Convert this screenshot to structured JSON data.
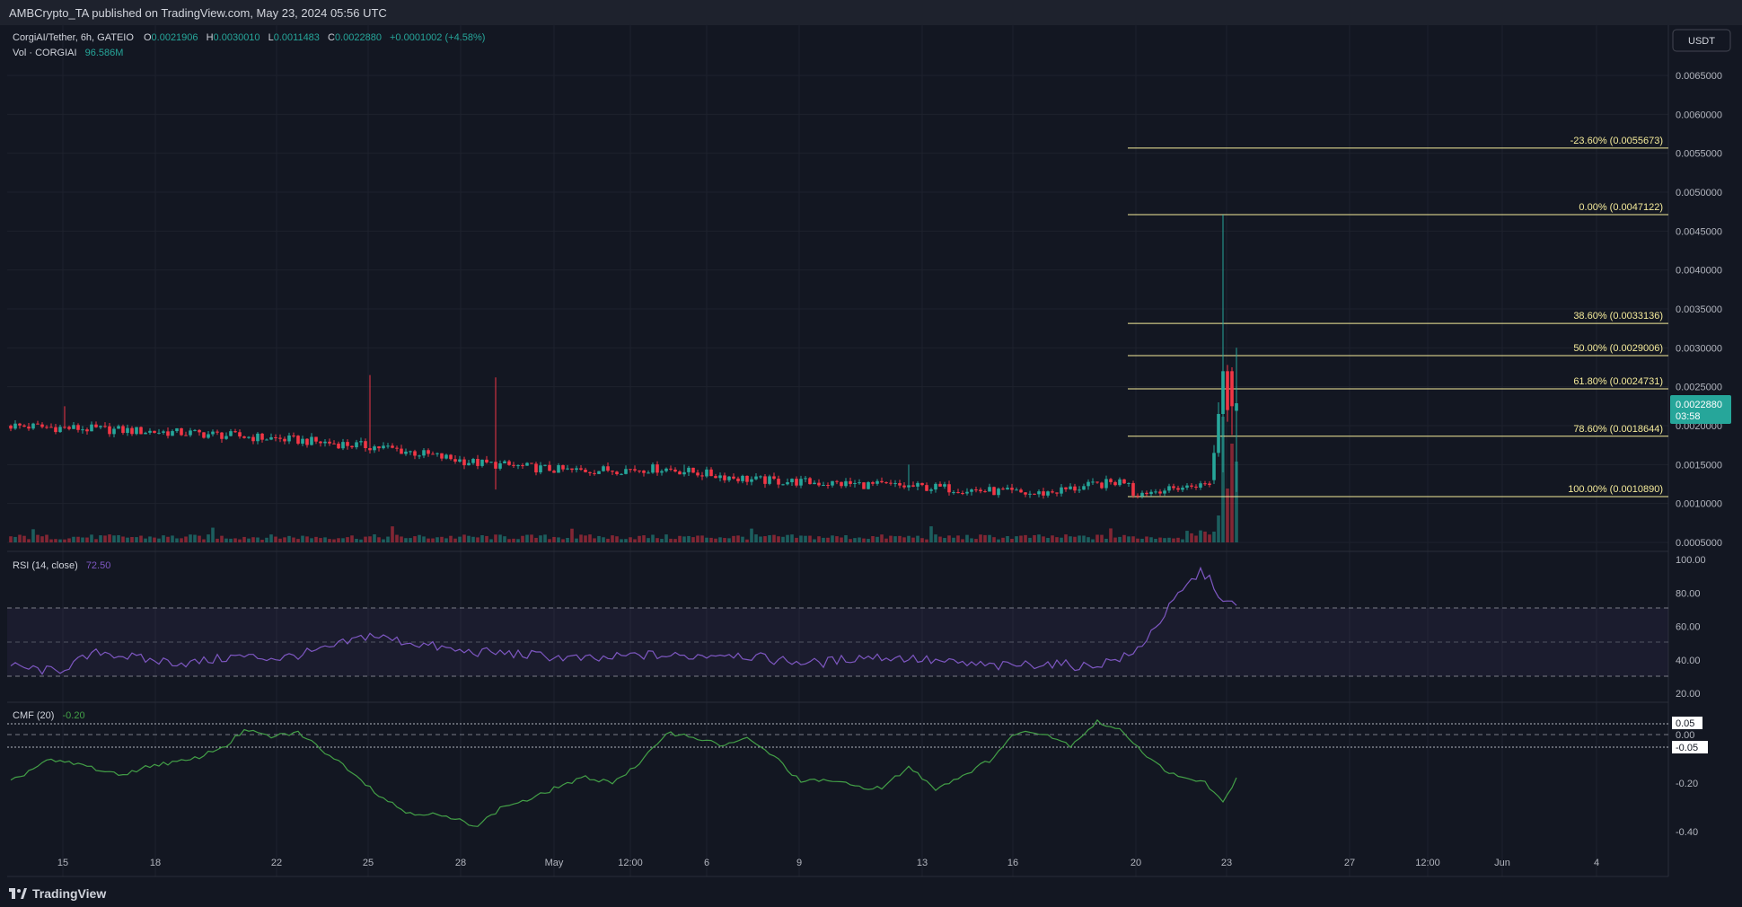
{
  "header": {
    "published": "AMBCrypto_TA published on TradingView.com, May 23, 2024 05:56 UTC"
  },
  "legend": {
    "symbol": "CorgiAI/Tether, 6h, GATEIO",
    "O_label": "O",
    "O": "0.0021906",
    "H_label": "H",
    "H": "0.0030010",
    "L_label": "L",
    "L": "0.0011483",
    "C_label": "C",
    "C": "0.0022880",
    "change": "+0.0001002 (+4.58%)",
    "vol_label": "Vol · CORGIAI",
    "vol_value": "96.586M"
  },
  "currency_button": "USDT",
  "last_price": {
    "price": "0.0022880",
    "countdown": "03:58"
  },
  "footer": {
    "brand": "TradingView"
  },
  "colors": {
    "background": "#131722",
    "up": "#26a69a",
    "down": "#f23645",
    "fib": "#f5eb9a",
    "rsi": "#7e57c2",
    "cmf": "#43a047"
  },
  "chart_data": [
    {
      "type": "candlestick",
      "title": "CorgiAI/Tether, 6h, GATEIO",
      "ylabel": "USDT",
      "ylim": [
        0.0003,
        0.0069
      ],
      "y_ticks": [
        "0.0065000",
        "0.0060000",
        "0.0055000",
        "0.0050000",
        "0.0045000",
        "0.0040000",
        "0.0035000",
        "0.0030000",
        "0.0025000",
        "0.0020000",
        "0.0015000",
        "0.0010000",
        "0.0005000"
      ],
      "x_tick_labels": [
        "15",
        "18",
        "22",
        "25",
        "28",
        "May",
        "12:00",
        "6",
        "9",
        "13",
        "16",
        "20",
        "23",
        "27",
        "12:00",
        "Jun",
        "4"
      ],
      "fib_levels": [
        {
          "label": "-23.60% (0.0055673)",
          "value": 0.0055673
        },
        {
          "label": "0.00% (0.0047122)",
          "value": 0.0047122
        },
        {
          "label": "38.60% (0.0033136)",
          "value": 0.0033136
        },
        {
          "label": "50.00% (0.0029006)",
          "value": 0.0029006
        },
        {
          "label": "61.80% (0.0024731)",
          "value": 0.0024731
        },
        {
          "label": "78.60% (0.0018644)",
          "value": 0.0018644
        },
        {
          "label": "100.00% (0.0010890)",
          "value": 0.001089
        }
      ],
      "price_anchors": [
        {
          "date": "Apr 13",
          "close": 0.002
        },
        {
          "date": "Apr 16",
          "close": 0.00195
        },
        {
          "date": "Apr 20",
          "close": 0.0019
        },
        {
          "date": "Apr 24",
          "close": 0.00182
        },
        {
          "date": "Apr 27",
          "close": 0.00172
        },
        {
          "date": "Apr 30",
          "close": 0.00152
        },
        {
          "date": "May 3",
          "close": 0.00142
        },
        {
          "date": "May 6",
          "close": 0.00145
        },
        {
          "date": "May 9",
          "close": 0.0013
        },
        {
          "date": "May 13",
          "close": 0.00125
        },
        {
          "date": "May 16",
          "close": 0.0012
        },
        {
          "date": "May 20",
          "close": 0.00112
        },
        {
          "date": "May 21",
          "close": 0.0013
        }
      ],
      "spike_candles": [
        {
          "label": "May 21 18:00",
          "o": 0.0013,
          "h": 0.00175,
          "l": 0.00125,
          "c": 0.00165
        },
        {
          "label": "May 22 00:00",
          "o": 0.00165,
          "h": 0.0023,
          "l": 0.0016,
          "c": 0.00215
        },
        {
          "label": "May 22 06:00",
          "o": 0.00215,
          "h": 0.00471,
          "l": 0.0014,
          "c": 0.0027
        },
        {
          "label": "May 22 12:00",
          "o": 0.0027,
          "h": 0.00278,
          "l": 0.00205,
          "c": 0.0022
        },
        {
          "label": "May 22 18:00",
          "o": 0.0027,
          "h": 0.00275,
          "l": 0.00188,
          "c": 0.00225
        },
        {
          "label": "May 23 00:00",
          "o": 0.0021906,
          "h": 0.003001,
          "l": 0.0011483,
          "c": 0.002288
        }
      ]
    },
    {
      "type": "line",
      "title": "RSI (14, close)",
      "current": "72.50",
      "ylim": [
        20,
        100
      ],
      "y_ticks": [
        "100.00",
        "80.00",
        "60.00",
        "40.00",
        "20.00"
      ],
      "bands": [
        70,
        50,
        30
      ],
      "points": [
        [
          0,
          36
        ],
        [
          10,
          33
        ],
        [
          20,
          45
        ],
        [
          30,
          40
        ],
        [
          40,
          38
        ],
        [
          50,
          42
        ],
        [
          60,
          41
        ],
        [
          70,
          46
        ],
        [
          80,
          55
        ],
        [
          85,
          52
        ],
        [
          90,
          50
        ],
        [
          100,
          45
        ],
        [
          110,
          44
        ],
        [
          120,
          42
        ],
        [
          130,
          40
        ],
        [
          140,
          43
        ],
        [
          150,
          42
        ],
        [
          160,
          44
        ],
        [
          170,
          40
        ],
        [
          180,
          38
        ],
        [
          190,
          42
        ],
        [
          200,
          41
        ],
        [
          210,
          38
        ],
        [
          220,
          36
        ],
        [
          230,
          38
        ],
        [
          240,
          36
        ],
        [
          250,
          43
        ],
        [
          255,
          60
        ],
        [
          260,
          78
        ],
        [
          265,
          93
        ],
        [
          268,
          85
        ],
        [
          270,
          74
        ],
        [
          273,
          72.5
        ]
      ]
    },
    {
      "type": "line",
      "title": "CMF (20)",
      "current": "-0.20",
      "ylim": [
        -0.45,
        0.12
      ],
      "y_ticks": [
        "0.05",
        "0.00",
        "-0.05",
        "-0.20",
        "-0.40"
      ],
      "bands": [
        0.05,
        0.0,
        -0.05
      ],
      "points": [
        [
          0,
          -0.22
        ],
        [
          8,
          -0.12
        ],
        [
          16,
          -0.14
        ],
        [
          24,
          -0.19
        ],
        [
          32,
          -0.14
        ],
        [
          40,
          -0.12
        ],
        [
          48,
          -0.05
        ],
        [
          52,
          0.02
        ],
        [
          58,
          -0.01
        ],
        [
          64,
          0.01
        ],
        [
          70,
          -0.08
        ],
        [
          76,
          -0.17
        ],
        [
          82,
          -0.28
        ],
        [
          88,
          -0.36
        ],
        [
          94,
          -0.37
        ],
        [
          100,
          -0.4
        ],
        [
          104,
          -0.42
        ],
        [
          110,
          -0.33
        ],
        [
          116,
          -0.3
        ],
        [
          122,
          -0.24
        ],
        [
          128,
          -0.2
        ],
        [
          134,
          -0.22
        ],
        [
          140,
          -0.14
        ],
        [
          146,
          0.01
        ],
        [
          152,
          -0.01
        ],
        [
          158,
          -0.05
        ],
        [
          164,
          -0.02
        ],
        [
          170,
          -0.1
        ],
        [
          176,
          -0.22
        ],
        [
          182,
          -0.21
        ],
        [
          188,
          -0.24
        ],
        [
          194,
          -0.25
        ],
        [
          200,
          -0.15
        ],
        [
          206,
          -0.25
        ],
        [
          212,
          -0.19
        ],
        [
          218,
          -0.12
        ],
        [
          224,
          0.01
        ],
        [
          230,
          0.01
        ],
        [
          236,
          -0.05
        ],
        [
          242,
          0.06
        ],
        [
          248,
          0.01
        ],
        [
          254,
          -0.12
        ],
        [
          260,
          -0.2
        ],
        [
          266,
          -0.22
        ],
        [
          270,
          -0.32
        ],
        [
          273,
          -0.2
        ]
      ]
    }
  ]
}
